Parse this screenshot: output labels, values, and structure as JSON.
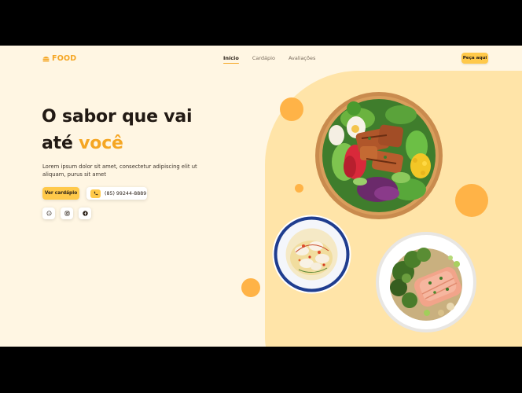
{
  "header": {
    "logo_text": "FOOD",
    "nav": [
      "Início",
      "Cardápio",
      "Avaliações"
    ],
    "order_label": "Peça aqui"
  },
  "hero": {
    "title_line1": "O sabor que vai",
    "title_line2_prefix": "até ",
    "title_line2_accent": "você",
    "description": "Lorem ipsum dolor sit amet, consectetur adipiscing elit ut aliquam, purus sit amet",
    "menu_button": "Ver cardápio",
    "phone": "(85) 99244-8889"
  },
  "socials": [
    "whatsapp-icon",
    "instagram-icon",
    "facebook-icon"
  ],
  "colors": {
    "accent": "#f5a623",
    "button": "#ffc94a",
    "background": "#fff6e3",
    "blob": "#ffe4a8",
    "circle": "#ffb347"
  }
}
